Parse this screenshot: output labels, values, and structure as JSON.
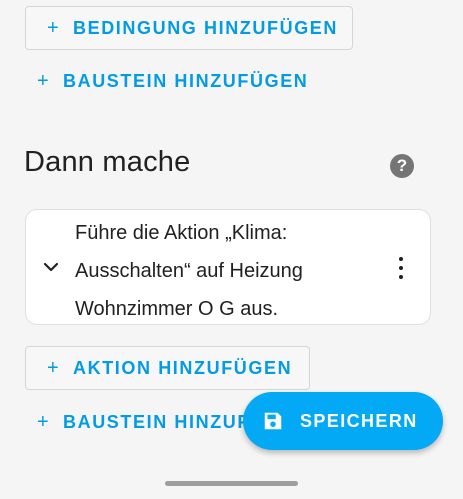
{
  "conditions": {
    "add_condition_label": "BEDINGUNG HINZUFÜGEN",
    "add_building_block_label": "BAUSTEIN HINZUFÜGEN"
  },
  "actions_section": {
    "title": "Dann mache",
    "help_icon": "?",
    "action_card": {
      "description_line1": "Führe die Aktion „Klima:",
      "description_line2": "Ausschalten“ auf Heizung",
      "description_line3": "Wohnzimmer O G aus."
    },
    "add_action_label": "AKTION HINZUFÜGEN",
    "add_building_block_label": "BAUSTEIN HINZUF"
  },
  "plus_glyph": "+",
  "save_fab": {
    "label": "SPEICHERN",
    "icon": "floppy-disk-icon"
  },
  "colors": {
    "accent": "#039be5",
    "fab_background": "#03a9f4",
    "page_background": "#f5f5f5",
    "card_background": "#ffffff"
  }
}
